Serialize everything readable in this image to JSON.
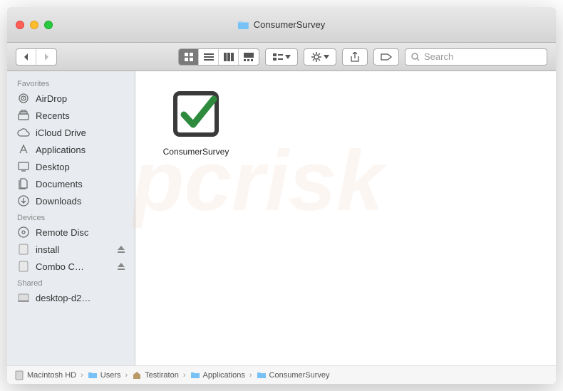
{
  "window": {
    "title": "ConsumerSurvey"
  },
  "search": {
    "placeholder": "Search"
  },
  "sidebar": {
    "sections": [
      {
        "label": "Favorites",
        "items": [
          {
            "label": "AirDrop",
            "icon": "airdrop-icon"
          },
          {
            "label": "Recents",
            "icon": "recents-icon"
          },
          {
            "label": "iCloud Drive",
            "icon": "cloud-icon"
          },
          {
            "label": "Applications",
            "icon": "applications-icon"
          },
          {
            "label": "Desktop",
            "icon": "desktop-icon"
          },
          {
            "label": "Documents",
            "icon": "documents-icon"
          },
          {
            "label": "Downloads",
            "icon": "downloads-icon"
          }
        ]
      },
      {
        "label": "Devices",
        "items": [
          {
            "label": "Remote Disc",
            "icon": "disc-icon"
          },
          {
            "label": "install",
            "icon": "disk-icon",
            "eject": true
          },
          {
            "label": "Combo C…",
            "icon": "disk-icon",
            "eject": true
          }
        ]
      },
      {
        "label": "Shared",
        "items": [
          {
            "label": "desktop-d2…",
            "icon": "computer-icon"
          }
        ]
      }
    ]
  },
  "files": [
    {
      "label": "ConsumerSurvey",
      "icon": "checkmark-app-icon"
    }
  ],
  "path": [
    {
      "label": "Macintosh HD",
      "icon": "hd-icon"
    },
    {
      "label": "Users",
      "icon": "folder-icon"
    },
    {
      "label": "Testiraton",
      "icon": "home-icon"
    },
    {
      "label": "Applications",
      "icon": "folder-icon"
    },
    {
      "label": "ConsumerSurvey",
      "icon": "folder-icon"
    }
  ]
}
